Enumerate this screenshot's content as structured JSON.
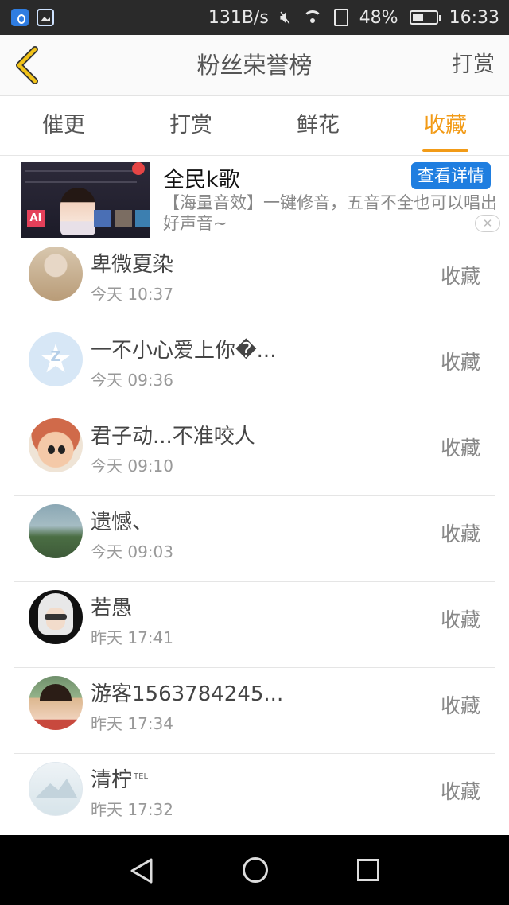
{
  "status_bar": {
    "network_speed": "131B/s",
    "battery_percent": "48%",
    "battery_level": 0.48,
    "time": "16:33",
    "icons": [
      "app-notify-icon",
      "image-icon",
      "mute-icon",
      "wifi-icon",
      "sim-icon",
      "battery-icon"
    ]
  },
  "header": {
    "back_icon": "chevron-left-icon",
    "title": "粉丝荣誉榜",
    "action_label": "打赏",
    "accent_color": "#f29b17"
  },
  "tabs": [
    {
      "label": "催更",
      "active": false
    },
    {
      "label": "打赏",
      "active": false
    },
    {
      "label": "鲜花",
      "active": false
    },
    {
      "label": "收藏",
      "active": true
    }
  ],
  "ad": {
    "title": "全民k歌",
    "button_label": "查看详情",
    "description": "【海量音效】一键修音，五音不全也可以唱出好声音~",
    "close_icon": "close-icon",
    "thumb_text": "AI"
  },
  "list": [
    {
      "name": "卑微夏染",
      "time": "今天 10:37",
      "action": "收藏",
      "tel": ""
    },
    {
      "name": "一不小心爱上你�...",
      "time": "今天 09:36",
      "action": "收藏",
      "tel": ""
    },
    {
      "name": "君子动...不准咬人",
      "time": "今天 09:10",
      "action": "收藏",
      "tel": ""
    },
    {
      "name": "遗憾、",
      "time": "今天 09:03",
      "action": "收藏",
      "tel": ""
    },
    {
      "name": "若愚",
      "time": "昨天 17:41",
      "action": "收藏",
      "tel": ""
    },
    {
      "name": "游客1563784245...",
      "time": "昨天 17:34",
      "action": "收藏",
      "tel": ""
    },
    {
      "name": "清柠",
      "time": "昨天 17:32",
      "action": "收藏",
      "tel": "TEL"
    }
  ],
  "nav_bar": {
    "icons": [
      "back-triangle-icon",
      "home-circle-icon",
      "recent-square-icon"
    ]
  }
}
